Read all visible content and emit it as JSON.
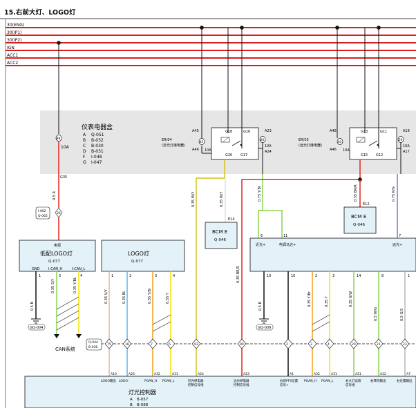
{
  "title": "15.右前大灯、LOGO灯",
  "power_rails": [
    "30(ENG)",
    "30(IP1)",
    "30(IP2)",
    "IGN",
    "ACC1",
    "ACC2"
  ],
  "fuse_box": {
    "title": "仪表电器盒",
    "connectors": [
      {
        "letter": "A",
        "code": "Q-051"
      },
      {
        "letter": "B",
        "code": "B-032"
      },
      {
        "letter": "C",
        "code": "B-030"
      },
      {
        "letter": "D",
        "code": "B-031"
      },
      {
        "letter": "F",
        "code": "I-048"
      },
      {
        "letter": "G",
        "code": "I-047"
      }
    ],
    "fuse_id": "89",
    "fuse_rating": "10A",
    "pin": "G35"
  },
  "relay_low": {
    "code": "ER/04",
    "name": "(近光灯继电器)",
    "fuse_left": {
      "id": "45",
      "rating": "10A",
      "pin_top": "A45",
      "pin_bot": "A46"
    },
    "pins": [
      "G18",
      "G16",
      "G20",
      "G17"
    ],
    "fuse_right": {
      "id": "60",
      "rating": "10A",
      "pin_top": "A23",
      "pin_bot": "A24"
    }
  },
  "relay_high": {
    "code": "ER/03",
    "name": "(远光灯继电器)",
    "fuse_left": {
      "id": "40",
      "rating": "10A",
      "pin_top": "A48",
      "pin_bot": "A46"
    },
    "pins": [
      "G13",
      "G11",
      "G15",
      "G12"
    ],
    "fuse_right": {
      "id": "59",
      "rating": "10A",
      "pin_top": "A18",
      "pin_bot": "A17"
    }
  },
  "wires": {
    "g35": "0.5 R",
    "w1": "0.35 W/Y",
    "w2": "0.35 W/Y",
    "w3": "0.75 Y/BI",
    "w4": "0.35 BR/R",
    "w5": "0.75 R/G",
    "gnd1": "0.5 B",
    "can_h": "0.35 G/Y",
    "can_l": "0.35 Y/BL",
    "logo1": "0.35 V/Y",
    "logo2": "0.35 BL",
    "logo3": "0.35 Y/Br",
    "logo4": "0.35 Y",
    "lamp_br": "0.35 BR/R",
    "lamp_gnd": "0.5 B",
    "lamp2": "0.35 Y/Br",
    "lamp3": "0.35 Y",
    "lamp4": "0.35 G/W",
    "lamp5": "0.5 W/G",
    "lamp6": "0.5 G/S"
  },
  "inline_connector_a": {
    "codes": [
      "I-002",
      "Q-062"
    ],
    "pin": "26"
  },
  "bcm_left": {
    "name": "BCM E",
    "code": "Q-046",
    "pin": "E14"
  },
  "bcm_right": {
    "name": "BCM E",
    "code": "Q-046",
    "pin": "E12"
  },
  "logo_low": {
    "title": "低配LOGO灯",
    "code": "Q-077",
    "power_label": "电源",
    "pins": [
      "GND",
      "I-CAN_H",
      "I-CAN_L"
    ],
    "pin_nums": [
      "1",
      "2",
      "3",
      "4"
    ]
  },
  "logo_lamp": {
    "title": "LOGO灯",
    "code": "Q-077",
    "pin_nums": [
      "1",
      "2",
      "3",
      "4"
    ]
  },
  "headlamp": {
    "labels": [
      "近光+",
      "电调马达+",
      "远光+"
    ],
    "pin_nums": [
      "6",
      "11",
      "7",
      "10",
      "10",
      "2",
      "3",
      "14",
      "8",
      "1"
    ]
  },
  "grounds": [
    "GQ-004",
    "GQ-009"
  ],
  "can_label": "CAN系统",
  "inline_connector_b": {
    "codes": [
      "Q-044",
      "B-036"
    ]
  },
  "inline_pins": [
    "75",
    "18",
    "7",
    "6",
    "93",
    "99",
    "2",
    "3",
    "4",
    "29",
    "21",
    "23"
  ],
  "module_pins": [
    "A10",
    "A26",
    "A32",
    "A31",
    "A24",
    "A23",
    "A1",
    "A32",
    "A31",
    "A21",
    "A22",
    "A7"
  ],
  "module_pin_labels": [
    "LOGO输出",
    "LOGO-",
    "PGAN_H",
    "PGAN_L",
    "近光继电器\n控制信号线",
    "远光继电器\n控制信号线",
    "右前PFS位置\n信号+",
    "PGAN_H",
    "PGAN_L",
    "右大灯远照\n信号线",
    "右转向输出",
    "右位置输出"
  ],
  "module": {
    "title": "灯光控制器",
    "connectors": [
      {
        "letter": "A",
        "code": "B-057"
      },
      {
        "letter": "B",
        "code": "B-088"
      }
    ]
  },
  "colors": {
    "rail": "#d81e1e",
    "panel": "#e6e6e6",
    "box": "#e3f1f8",
    "red": "#e0261b",
    "yellow": "#f4e200",
    "green": "#8bd34b",
    "orange": "#f0a21c",
    "blue": "#5fb3e8",
    "purple": "#8a6cc8"
  }
}
